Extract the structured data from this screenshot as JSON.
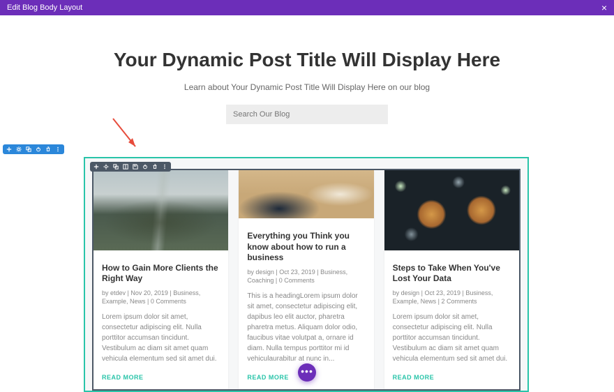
{
  "topbar": {
    "title": "Edit Blog Body Layout",
    "close": "×"
  },
  "header": {
    "title": "Your Dynamic Post Title Will Display Here",
    "subtitle": "Learn about Your Dynamic Post Title Will Display Here on our blog",
    "search_placeholder": "Search Our Blog"
  },
  "fab": "•••",
  "posts": [
    {
      "title": "How to Gain More Clients the Right Way",
      "meta": "by etdev | Nov 20, 2019 | Business, Example, News | 0 Comments",
      "excerpt": "Lorem ipsum dolor sit amet, consectetur adipiscing elit. Nulla porttitor accumsan tincidunt. Vestibulum ac diam sit amet quam vehicula elementum sed sit amet dui.",
      "read_more": "READ MORE"
    },
    {
      "title": "Everything you Think you know about how to run a business",
      "meta": "by design | Oct 23, 2019 | Business, Coaching | 0 Comments",
      "excerpt": "This is a headingLorem ipsum dolor sit amet, consectetur adipiscing elit, dapibus leo elit auctor, pharetra pharetra metus. Aliquam dolor odio, faucibus vitae volutpat a, ornare id diam. Nulla tempus porttitor mi id vehiculaurabitur at nunc in...",
      "read_more": "READ MORE"
    },
    {
      "title": "Steps to Take When You've Lost Your Data",
      "meta": "by design | Oct 23, 2019 | Business, Example, News | 2 Comments",
      "excerpt": "Lorem ipsum dolor sit amet, consectetur adipiscing elit. Nulla porttitor accumsan tincidunt. Vestibulum ac diam sit amet quam vehicula elementum sed sit amet dui.",
      "read_more": "READ MORE"
    }
  ]
}
